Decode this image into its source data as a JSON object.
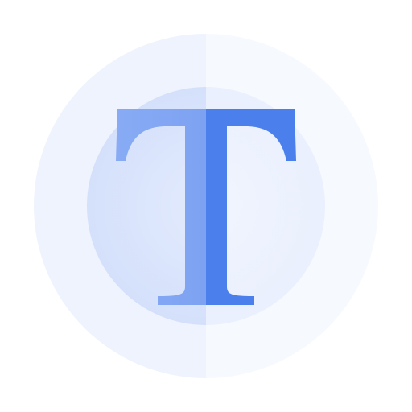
{
  "icon": {
    "glyph": "T",
    "semantic": "text-tool-icon",
    "colors": {
      "background": "#ffffff",
      "outer_ring_left": "#eef3fd",
      "outer_ring_right": "#f6f9fe",
      "inner_disc_left": "#d6e1fb",
      "inner_disc_right": "#eaf0fd",
      "glyph_left": "#7ea3f3",
      "glyph_right": "#4a7fec"
    }
  }
}
